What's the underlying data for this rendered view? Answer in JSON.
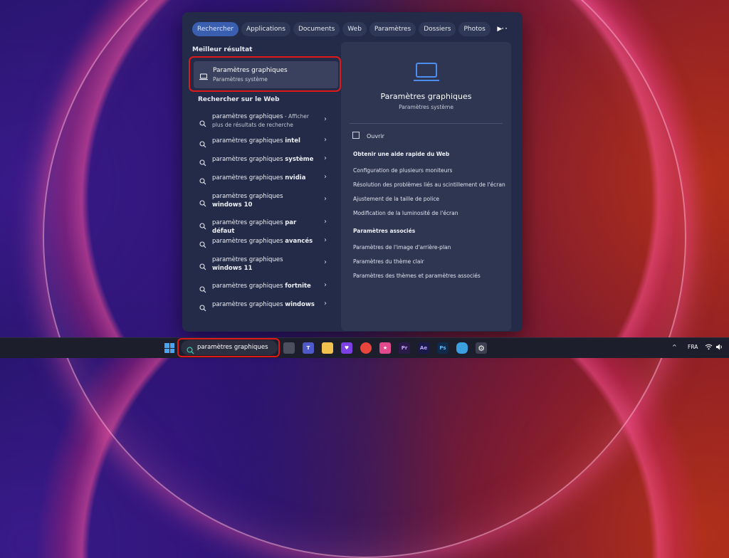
{
  "search_panel": {
    "tabs": [
      "Rechercher",
      "Applications",
      "Documents",
      "Web",
      "Paramètres",
      "Dossiers",
      "Photos"
    ],
    "more_label": "···",
    "best_match": {
      "section_title": "Meilleur résultat",
      "title": "Paramètres graphiques",
      "subtitle": "Paramètres système"
    },
    "web": {
      "section_title": "Rechercher sur le Web",
      "items": [
        {
          "prefix": "paramètres graphiques",
          "bold": "",
          "suffix": " - Afficher plus de résultats de recherche"
        },
        {
          "prefix": "paramètres graphiques ",
          "bold": "intel",
          "suffix": ""
        },
        {
          "prefix": "paramètres graphiques ",
          "bold": "système",
          "suffix": ""
        },
        {
          "prefix": "paramètres graphiques ",
          "bold": "nvidia",
          "suffix": ""
        },
        {
          "prefix": "paramètres graphiques ",
          "bold": "windows 10",
          "suffix": ""
        },
        {
          "prefix": "paramètres graphiques ",
          "bold": "par défaut",
          "suffix": ""
        },
        {
          "prefix": "paramètres graphiques ",
          "bold": "avancés",
          "suffix": ""
        },
        {
          "prefix": "paramètres graphiques ",
          "bold": "windows 11",
          "suffix": ""
        },
        {
          "prefix": "paramètres graphiques ",
          "bold": "fortnite",
          "suffix": ""
        },
        {
          "prefix": "paramètres graphiques ",
          "bold": "windows",
          "suffix": ""
        }
      ]
    },
    "preview": {
      "title": "Paramètres graphiques",
      "subtitle": "Paramètres système",
      "open_label": "Ouvrir",
      "web_help_title": "Obtenir une aide rapide du Web",
      "web_help_links": [
        "Configuration de plusieurs moniteurs",
        "Résolution des problèmes liés au scintillement de l'écran",
        "Ajustement de la taille de police",
        "Modification de la luminosité de l'écran"
      ],
      "related_title": "Paramètres associés",
      "related_links": [
        "Paramètres de l'image d'arrière-plan",
        "Paramètres du thème clair",
        "Paramètres des thèmes et paramètres associés"
      ]
    }
  },
  "taskbar": {
    "search_value": "paramètres graphiques",
    "language": "FRA",
    "apps": [
      {
        "name": "explorer-app-icon",
        "label": "",
        "color": "#4b4f5e"
      },
      {
        "name": "teams-icon",
        "label": "T",
        "color": "#5059c9"
      },
      {
        "name": "file-explorer-icon",
        "label": "",
        "color": "#f2c14e"
      },
      {
        "name": "heart-app-icon",
        "label": "♥",
        "color": "#7b3fe4"
      },
      {
        "name": "chrome-icon",
        "label": "",
        "color": "#e8453c"
      },
      {
        "name": "star-app-icon",
        "label": "★",
        "color": "#e04a8c"
      },
      {
        "name": "premiere-icon",
        "label": "Pr",
        "color": "#2a1a4a"
      },
      {
        "name": "after-effects-icon",
        "label": "Ae",
        "color": "#1a1a4a"
      },
      {
        "name": "photoshop-icon",
        "label": "Ps",
        "color": "#0f2a4a"
      },
      {
        "name": "copilot-icon",
        "label": "",
        "color": "#3aa0e0"
      },
      {
        "name": "settings-gear-icon",
        "label": "⚙",
        "color": "#3c4050"
      }
    ]
  }
}
